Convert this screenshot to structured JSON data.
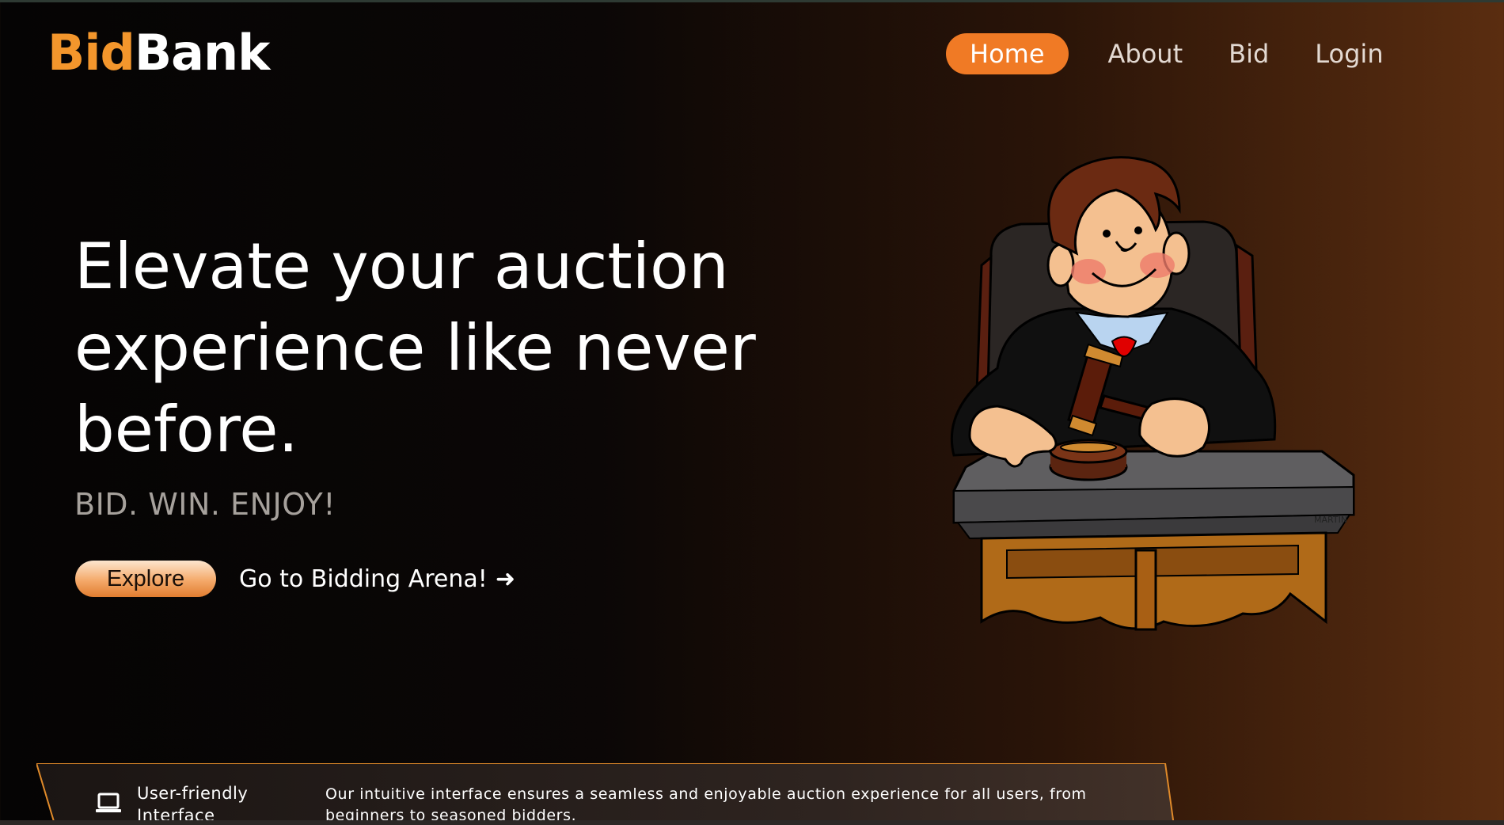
{
  "brand": {
    "part1": "Bid",
    "part2": "Bank"
  },
  "nav": {
    "items": [
      {
        "label": "Home",
        "active": true
      },
      {
        "label": "About",
        "active": false
      },
      {
        "label": "Bid",
        "active": false
      },
      {
        "label": "Login",
        "active": false
      }
    ]
  },
  "hero": {
    "title": "Elevate your auction experience like never before.",
    "tagline": "BID. WIN. ENJOY!",
    "explore_label": "Explore",
    "arena_label": "Go to Bidding Arena!",
    "image_signature": "MARTIN"
  },
  "features": [
    {
      "icon": "laptop-icon",
      "title": "User-friendly Interface",
      "description": "Our intuitive interface ensures a seamless and enjoyable auction experience for all users, from beginners to seasoned bidders."
    }
  ],
  "colors": {
    "accent": "#f07a25",
    "brand_orange": "#f3962c",
    "background_dark": "#050404",
    "background_brown": "#5a2d10"
  }
}
